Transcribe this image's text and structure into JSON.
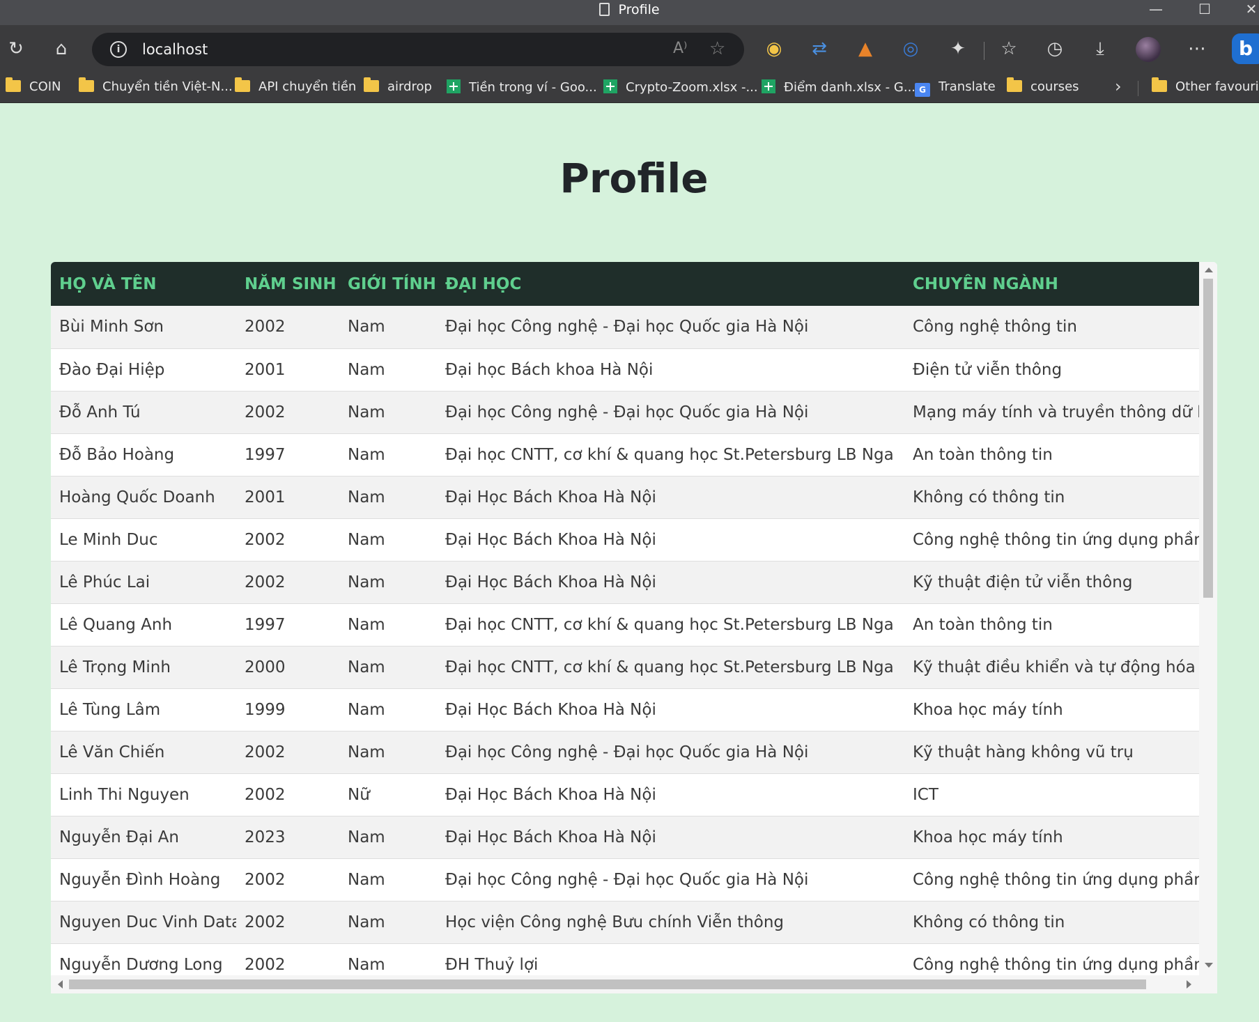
{
  "window": {
    "title": "Profile"
  },
  "address_bar": {
    "url": "localhost"
  },
  "bookmarks": [
    {
      "label": "COIN",
      "icon": "folder-icon"
    },
    {
      "label": "Chuyển tiền Việt-N...",
      "icon": "folder-icon"
    },
    {
      "label": "API chuyển tiền",
      "icon": "folder-icon"
    },
    {
      "label": "airdrop",
      "icon": "folder-icon"
    },
    {
      "label": "Tiền trong ví - Goo...",
      "icon": "sheets-icon"
    },
    {
      "label": "Crypto-Zoom.xlsx -...",
      "icon": "sheets-icon"
    },
    {
      "label": "Điểm danh.xlsx - G...",
      "icon": "sheets-icon"
    },
    {
      "label": "Translate",
      "icon": "google-translate-icon"
    },
    {
      "label": "courses",
      "icon": "folder-icon"
    },
    {
      "label": "Other favourite",
      "icon": "folder-icon"
    }
  ],
  "page": {
    "title": "Profile"
  },
  "table": {
    "headers": [
      "HỌ VÀ TÊN",
      "NĂM SINH",
      "GIỚI TÍNH",
      "ĐẠI HỌC",
      "CHUYÊN NGÀNH"
    ],
    "rows": [
      [
        "Bùi Minh Sơn",
        "2002",
        "Nam",
        "Đại học Công nghệ - Đại học Quốc gia Hà Nội",
        "Công nghệ thông tin"
      ],
      [
        "Đào Đại Hiệp",
        "2001",
        "Nam",
        "Đại học Bách khoa Hà Nội",
        "Điện tử viễn thông"
      ],
      [
        "Đỗ Anh Tú",
        "2002",
        "Nam",
        "Đại học Công nghệ - Đại học Quốc gia Hà Nội",
        "Mạng máy tính và truyền thông dữ liệu"
      ],
      [
        "Đỗ Bảo Hoàng",
        "1997",
        "Nam",
        "Đại học CNTT, cơ khí & quang học St.Petersburg LB Nga",
        "An toàn thông tin"
      ],
      [
        "Hoàng Quốc Doanh",
        "2001",
        "Nam",
        "Đại Học Bách Khoa Hà Nội",
        "Không có thông tin"
      ],
      [
        "Le Minh Duc",
        "2002",
        "Nam",
        "Đại Học Bách Khoa Hà Nội",
        "Công nghệ thông tin ứng dụng phần m"
      ],
      [
        "Lê Phúc Lai",
        "2002",
        "Nam",
        "Đại Học Bách Khoa Hà Nội",
        "Kỹ thuật điện tử viễn thông"
      ],
      [
        "Lê Quang Anh",
        "1997",
        "Nam",
        "Đại học CNTT, cơ khí & quang học St.Petersburg LB Nga",
        "An toàn thông tin"
      ],
      [
        "Lê Trọng Minh",
        "2000",
        "Nam",
        "Đại học CNTT, cơ khí & quang học St.Petersburg LB Nga",
        "Kỹ thuật điều khiển và tự động hóa"
      ],
      [
        "Lê Tùng Lâm",
        "1999",
        "Nam",
        "Đại Học Bách Khoa Hà Nội",
        "Khoa học máy tính"
      ],
      [
        "Lê Văn Chiến",
        "2002",
        "Nam",
        "Đại học Công nghệ - Đại học Quốc gia Hà Nội",
        "Kỹ thuật hàng không vũ trụ"
      ],
      [
        "Linh Thi Nguyen",
        "2002",
        "Nữ",
        "Đại Học Bách Khoa Hà Nội",
        "ICT"
      ],
      [
        "Nguyễn Đại An",
        "2023",
        "Nam",
        "Đại Học Bách Khoa Hà Nội",
        "Khoa học máy tính"
      ],
      [
        "Nguyễn Đình Hoàng",
        "2002",
        "Nam",
        "Đại học Công nghệ - Đại học Quốc gia Hà Nội",
        "Công nghệ thông tin ứng dụng phần m"
      ],
      [
        "Nguyen Duc Vinh Data",
        "2002",
        "Nam",
        "Học viện Công nghệ Bưu chính Viễn thông",
        "Không có thông tin"
      ],
      [
        "Nguyễn Dương Long",
        "2002",
        "Nam",
        "ĐH Thuỷ lợi",
        "Công nghệ thông tin ứng dụng phần m"
      ]
    ]
  },
  "colors": {
    "page_background": "#d6f2dc",
    "header_background": "#1f2e2a",
    "header_text": "#5fcf8e",
    "row_alt": "#f2f2f2"
  }
}
